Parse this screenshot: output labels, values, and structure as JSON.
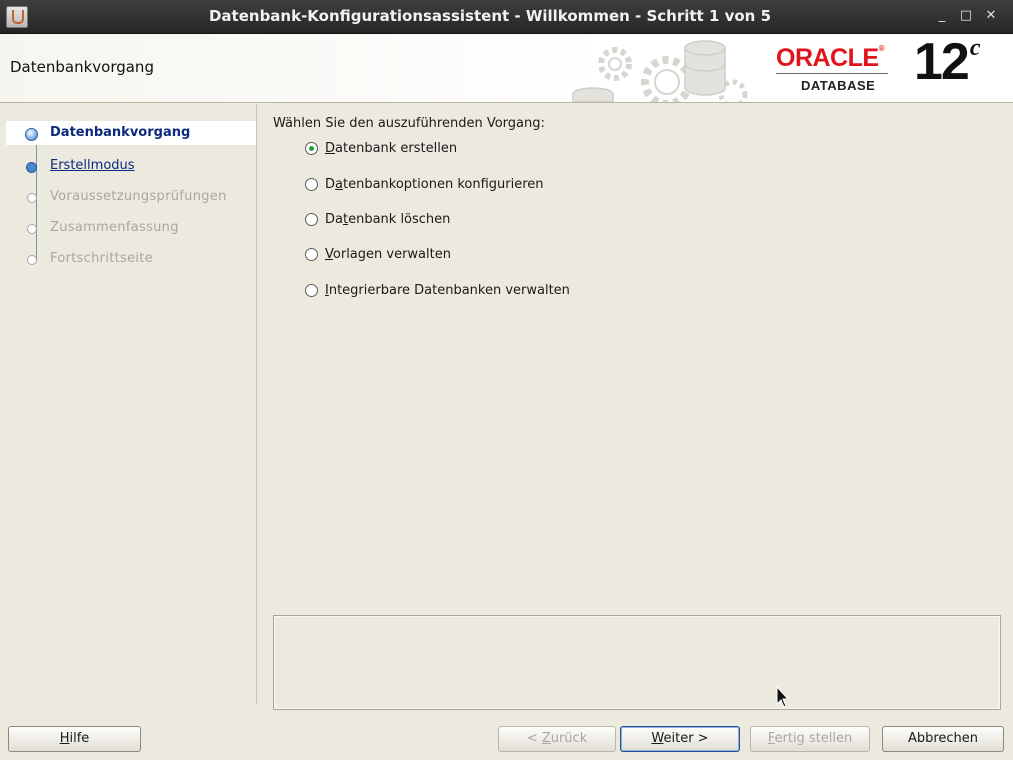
{
  "window": {
    "title": "Datenbank-Konfigurationsassistent - Willkommen - Schritt 1 von 5",
    "minimize_glyph": "_",
    "maximize_glyph": "□",
    "close_glyph": "✕"
  },
  "header": {
    "title": "Datenbankvorgang",
    "brand": "ORACLE",
    "product": "DATABASE",
    "version": "12",
    "version_suffix": "c"
  },
  "nav": {
    "items": [
      {
        "label": "Datenbankvorgang",
        "state": "current"
      },
      {
        "label": "Erstellmodus",
        "state": "link"
      },
      {
        "label": "Voraussetzungsprüfungen",
        "state": "disabled"
      },
      {
        "label": "Zusammenfassung",
        "state": "disabled"
      },
      {
        "label": "Fortschrittseite",
        "state": "disabled"
      }
    ]
  },
  "main": {
    "prompt": "Wählen Sie den auszuführenden Vorgang:",
    "options": [
      {
        "mn": "D",
        "rest": "atenbank erstellen",
        "checked": true
      },
      {
        "pre": "D",
        "mn": "a",
        "rest": "tenbankoptionen konfigurieren",
        "checked": false
      },
      {
        "pre": "Da",
        "mn": "t",
        "rest": "enbank löschen",
        "checked": false
      },
      {
        "mn": "V",
        "rest": "orlagen verwalten",
        "checked": false
      },
      {
        "mn": "I",
        "rest": "ntegrierbare Datenbanken verwalten",
        "checked": false
      }
    ]
  },
  "buttons": {
    "help": {
      "mn": "H",
      "rest": "ilfe"
    },
    "back": {
      "pre": "< ",
      "mn": "Z",
      "rest": "urück"
    },
    "next": {
      "mn": "W",
      "rest": "eiter >"
    },
    "finish": {
      "mn": "F",
      "rest": "ertig stellen"
    },
    "cancel": "Abbrechen"
  },
  "colors": {
    "oracle_red": "#e2141b",
    "nav_link": "#0d2a7d",
    "radio_selected": "#2f9e3a",
    "background": "#ece9df"
  }
}
